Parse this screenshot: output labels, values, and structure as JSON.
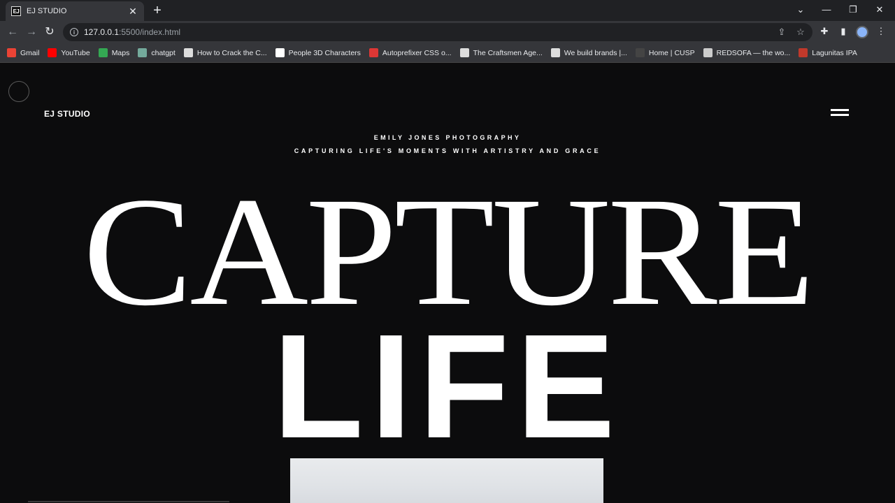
{
  "browser": {
    "tab_title": "EJ STUDIO",
    "favicon_text": "EJ",
    "url_host": "127.0.0.1",
    "url_path": ":5500/index.html",
    "bookmarks": [
      {
        "label": "Gmail",
        "color": "#ea4335"
      },
      {
        "label": "YouTube",
        "color": "#ff0000"
      },
      {
        "label": "Maps",
        "color": "#34a853"
      },
      {
        "label": "chatgpt",
        "color": "#74aa9c"
      },
      {
        "label": "How to Crack the C...",
        "color": "#dddddd"
      },
      {
        "label": "People 3D Characters",
        "color": "#ffffff"
      },
      {
        "label": "Autoprefixer CSS o...",
        "color": "#dd3735"
      },
      {
        "label": "The Craftsmen Age...",
        "color": "#dddddd"
      },
      {
        "label": "We build brands |...",
        "color": "#dddddd"
      },
      {
        "label": "Home | CUSP",
        "color": "#444444"
      },
      {
        "label": "REDSOFA — the wo...",
        "color": "#cccccc"
      },
      {
        "label": "Lagunitas IPA",
        "color": "#c0392b"
      }
    ]
  },
  "site": {
    "logo": "EJ STUDIO",
    "subtitle": "EMILY JONES PHOTOGRAPHY",
    "tagline": "CAPTURING LIFE'S MOMENTS WITH ARTISTRY AND GRACE",
    "headline_top": "CAPTURE",
    "headline_bottom": "LIFE"
  }
}
